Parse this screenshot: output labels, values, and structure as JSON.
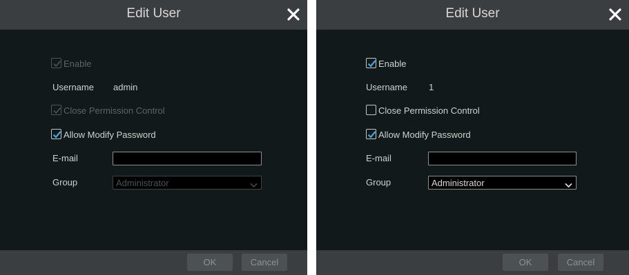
{
  "left": {
    "title": "Edit User",
    "enable_label": "Enable",
    "username_label": "Username",
    "username_value": "admin",
    "close_permission_label": "Close Permission Control",
    "allow_modify_label": "Allow Modify Password",
    "email_label": "E-mail",
    "email_value": "",
    "group_label": "Group",
    "group_value": "Administrator",
    "ok_label": "OK",
    "cancel_label": "Cancel"
  },
  "right": {
    "title": "Edit User",
    "enable_label": "Enable",
    "username_label": "Username",
    "username_value": "1",
    "close_permission_label": "Close Permission Control",
    "allow_modify_label": "Allow Modify Password",
    "email_label": "E-mail",
    "email_value": "",
    "group_label": "Group",
    "group_value": "Administrator",
    "ok_label": "OK",
    "cancel_label": "Cancel"
  },
  "colors": {
    "dialog_bg": "#12191a",
    "titlebar_bg": "#3a3e40",
    "check_accent": "#3aa8e8"
  }
}
